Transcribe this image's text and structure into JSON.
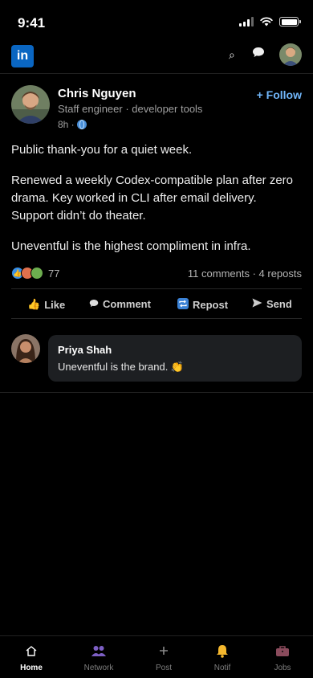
{
  "status_bar": {
    "time": "9:41"
  },
  "header": {
    "logo_text": "in",
    "search_icon": "search-icon",
    "messages_icon": "messages-icon"
  },
  "post": {
    "author": {
      "name": "Chris Nguyen",
      "headline": "Staff engineer · developer tools",
      "time": "8h ·",
      "visibility_icon": "globe-icon"
    },
    "follow_label": "+ Follow",
    "paragraphs": [
      "Public thank-you for a quiet week.",
      "Renewed a weekly Codex-compatible plan after zero drama. Key worked in CLI after email delivery. Support didn’t do theater.",
      "Uneventful is the highest compliment in infra."
    ],
    "reaction_count": "77",
    "comments_reposts": "11 comments · 4 reposts",
    "actions": {
      "like": "Like",
      "comment": "Comment",
      "repost": "Repost",
      "send": "Send"
    }
  },
  "comment": {
    "author": "Priya Shah",
    "text": "Uneventful is the brand. 👏"
  },
  "bottom_nav": {
    "items": [
      {
        "label": "Home",
        "icon": "home-icon",
        "active": true
      },
      {
        "label": "Network",
        "icon": "network-icon"
      },
      {
        "label": "Post",
        "icon": "plus-icon"
      },
      {
        "label": "Notif",
        "icon": "bell-icon"
      },
      {
        "label": "Jobs",
        "icon": "briefcase-icon"
      }
    ]
  },
  "colors": {
    "background": "#000000",
    "brand_blue": "#0a66c2",
    "follow_blue": "#71b7fb",
    "comment_bubble": "#1d1f22"
  }
}
